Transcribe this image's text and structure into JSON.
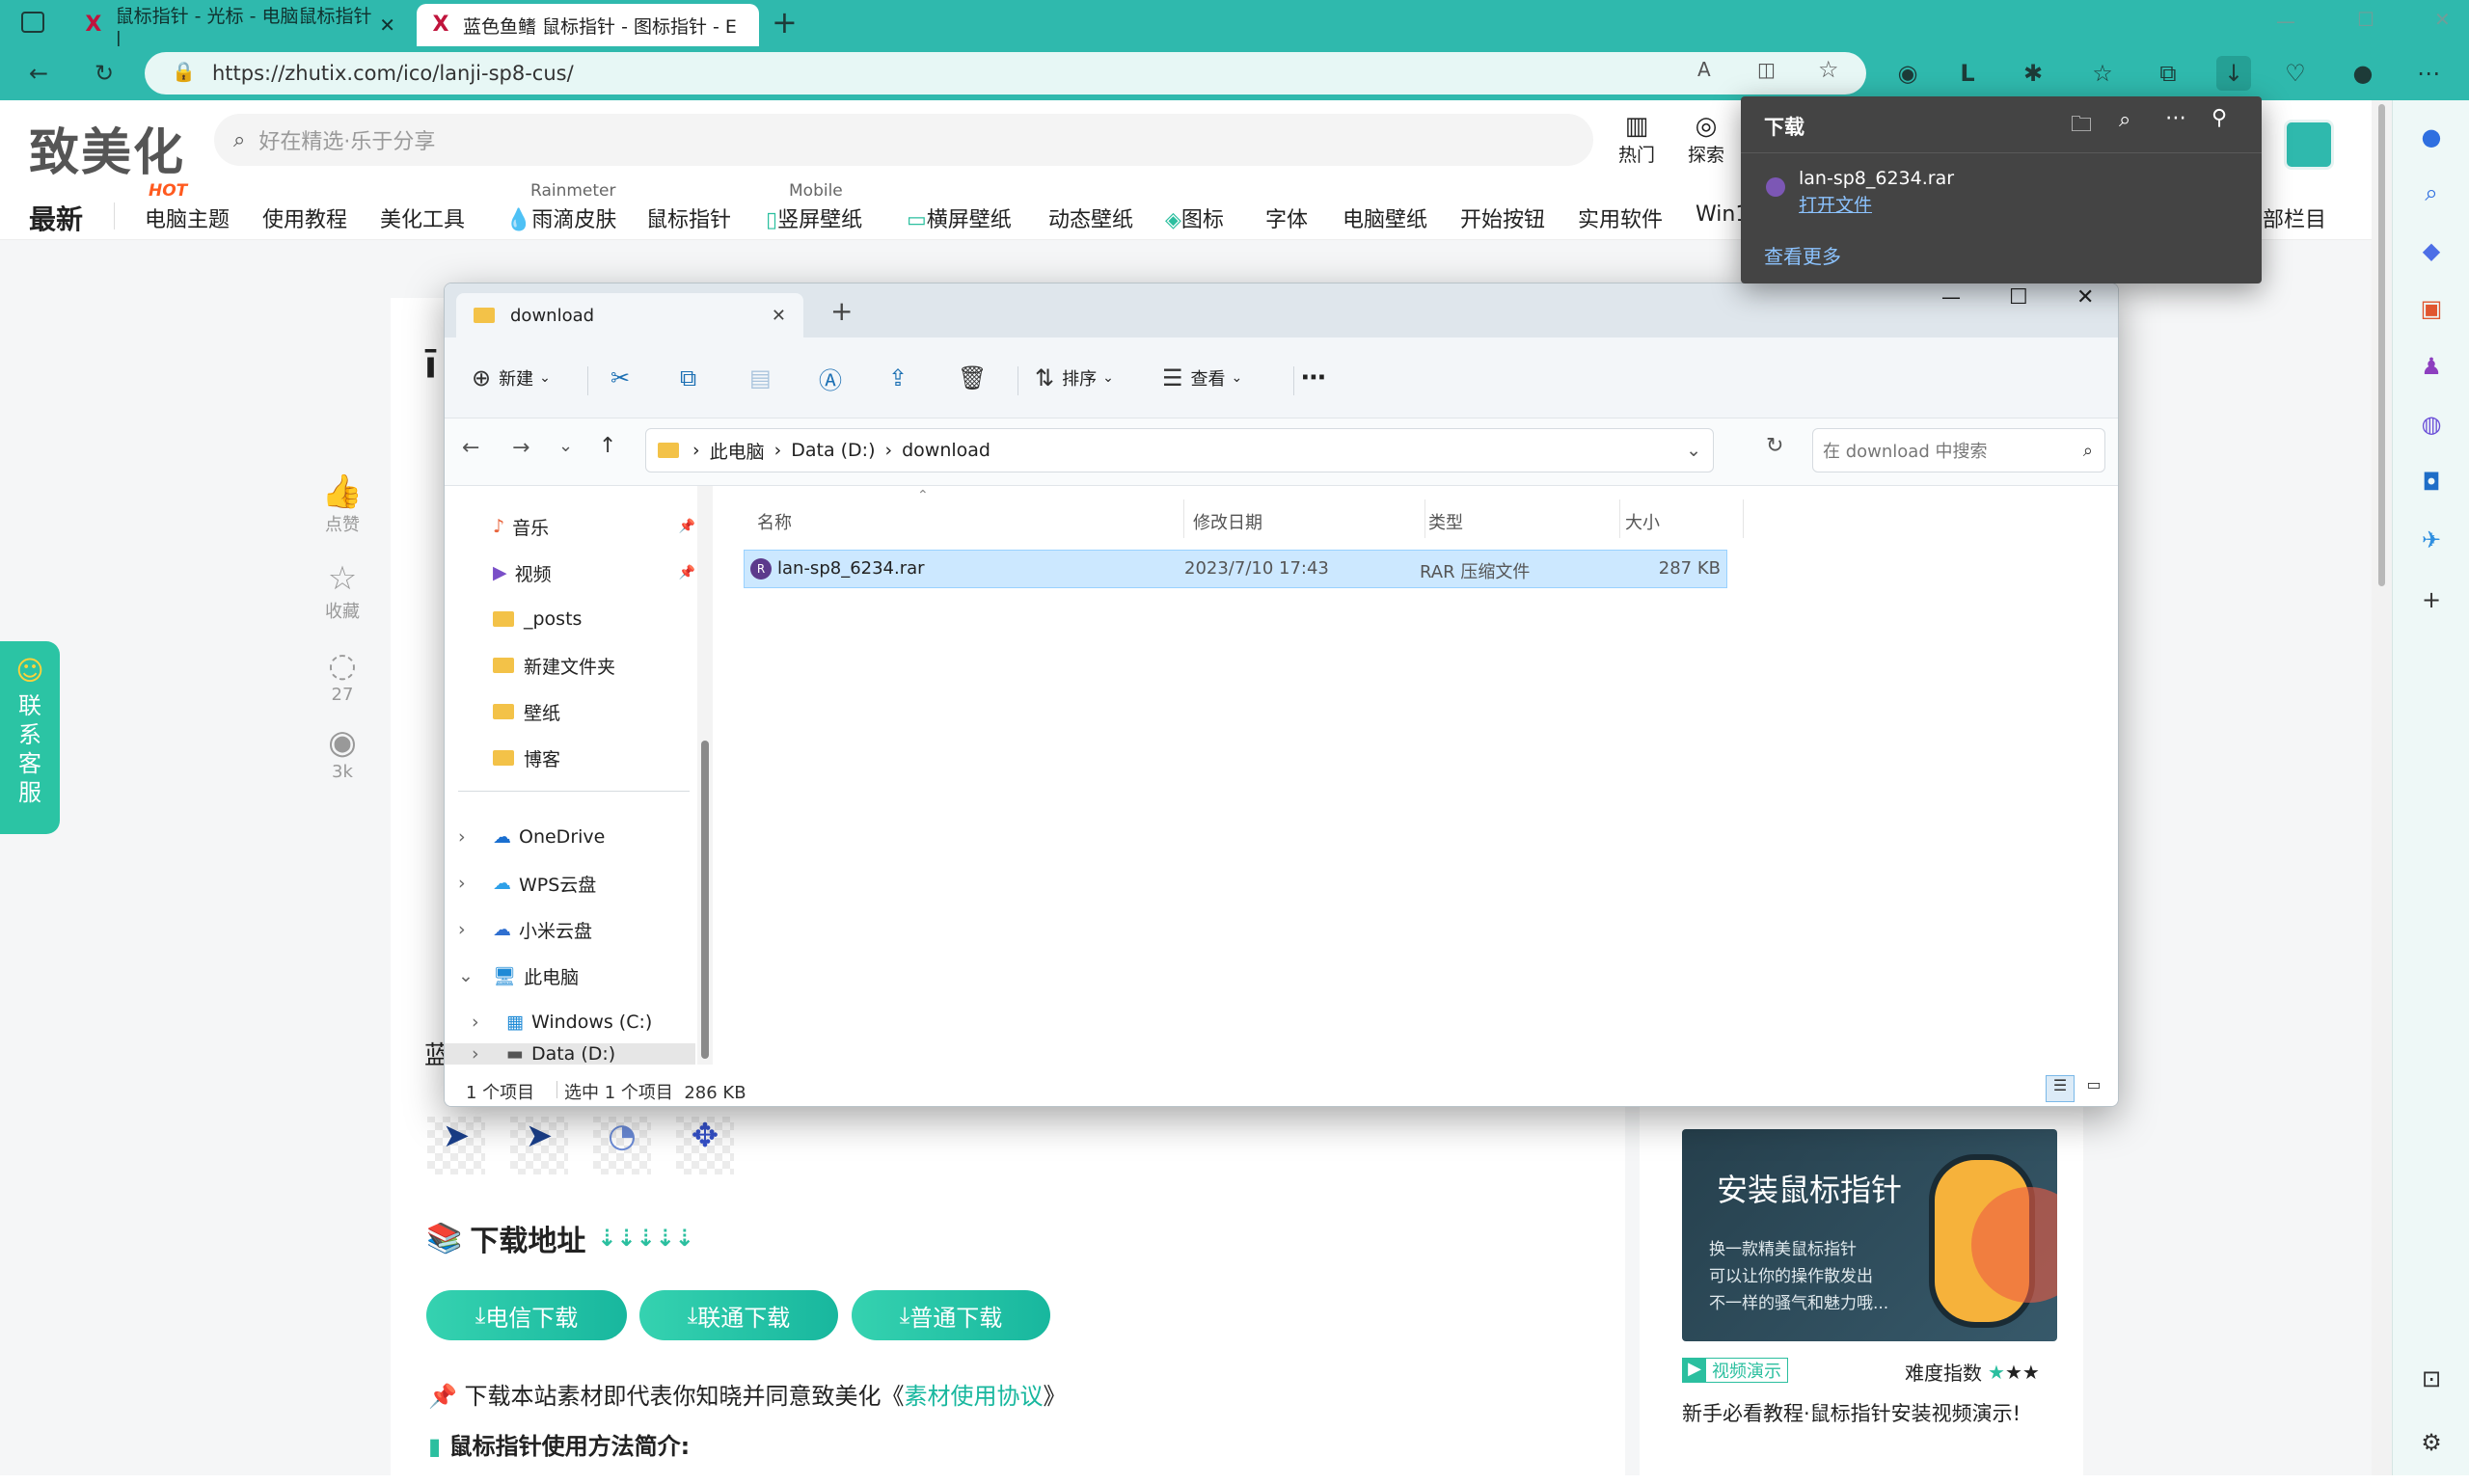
{
  "browser": {
    "tabs": [
      {
        "title": "鼠标指针 - 光标 - 电脑鼠标指针 |",
        "active": false
      },
      {
        "title": "蓝色鱼鳍 鼠标指针 - 图标指针 - E",
        "active": true
      }
    ],
    "url": "https://zhutix.com/ico/lanji-sp8-cus/"
  },
  "site": {
    "logo": "致美化",
    "search_placeholder": "好在精选·乐于分享",
    "hot_label": "热门",
    "explore_label": "探索",
    "nav": [
      {
        "label": "最新"
      },
      {
        "label": "电脑主题",
        "sup": "HOT"
      },
      {
        "label": "使用教程"
      },
      {
        "label": "美化工具"
      },
      {
        "label": "雨滴皮肤",
        "sup": "Rainmeter"
      },
      {
        "label": "鼠标指针"
      },
      {
        "label": "竖屏壁纸",
        "sup": "Mobile"
      },
      {
        "label": "横屏壁纸"
      },
      {
        "label": "动态壁纸"
      },
      {
        "label": "图标"
      },
      {
        "label": "字体"
      },
      {
        "label": "电脑壁纸"
      },
      {
        "label": "开始按钮"
      },
      {
        "label": "实用软件"
      },
      {
        "label": "Win1"
      },
      {
        "label": "部栏目"
      }
    ],
    "side_actions": [
      {
        "label": "点赞"
      },
      {
        "label": "收藏"
      },
      {
        "label": "27"
      },
      {
        "label": "3k"
      }
    ],
    "service_label": "联系客服",
    "download_heading": "下载地址",
    "download_buttons": [
      "电信下载",
      "联通下载",
      "普通下载"
    ],
    "agreement_prefix": "下载本站素材即代表你知晓并同意致美化《",
    "agreement_link": "素材使用协议",
    "agreement_suffix": "》",
    "usage_heading": "鼠标指针使用方法简介:",
    "card": {
      "title": "安装鼠标指针",
      "lines": [
        "换一款精美鼠标指针",
        "可以让你的操作散发出",
        "不一样的骚气和魅力哦..."
      ],
      "video_label": "视频演示",
      "difficulty_label": "难度指数",
      "difficulty": 3,
      "caption": "新手必看教程·鼠标指针安装视频演示!"
    }
  },
  "download_popup": {
    "title": "下载",
    "filename": "lan-sp8_6234.rar",
    "open_file": "打开文件",
    "see_more": "查看更多"
  },
  "explorer": {
    "tab_title": "download",
    "toolbar": {
      "new": "新建",
      "sort": "排序",
      "view": "查看"
    },
    "breadcrumb": [
      "此电脑",
      "Data (D:)",
      "download"
    ],
    "search_placeholder": "在 download 中搜索",
    "nav_items": [
      {
        "label": "音乐",
        "pinned": true
      },
      {
        "label": "视频",
        "pinned": true
      },
      {
        "label": "_posts"
      },
      {
        "label": "新建文件夹"
      },
      {
        "label": "壁纸"
      },
      {
        "label": "博客"
      },
      {
        "label": "OneDrive"
      },
      {
        "label": "WPS云盘"
      },
      {
        "label": "小米云盘"
      },
      {
        "label": "此电脑"
      },
      {
        "label": "Windows (C:)"
      },
      {
        "label": "Data (D:)"
      }
    ],
    "columns": [
      "名称",
      "修改日期",
      "类型",
      "大小"
    ],
    "files": [
      {
        "name": "lan-sp8_6234.rar",
        "modified": "2023/7/10 17:43",
        "type": "RAR 压缩文件",
        "size": "287 KB"
      }
    ],
    "status": {
      "count": "1 个项目",
      "selected": "选中 1 个项目  286 KB"
    }
  },
  "colors": {
    "accent": "#2fb9ad",
    "green": "#18b79e",
    "select": "#cce8ff"
  }
}
